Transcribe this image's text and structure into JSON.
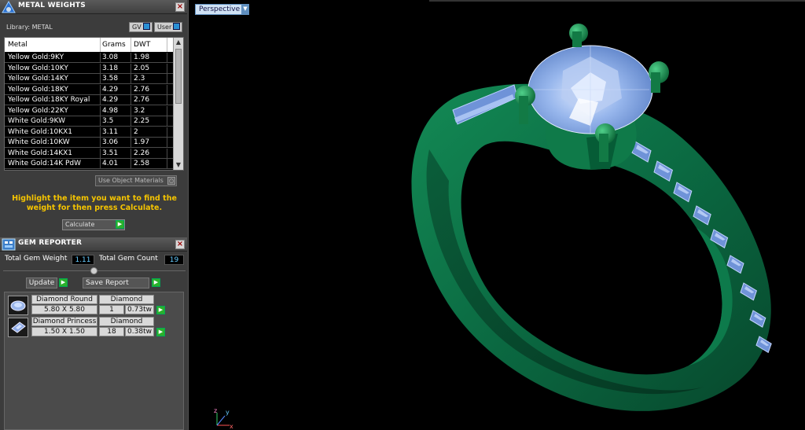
{
  "metal_panel": {
    "title": "METAL WEIGHTS",
    "library_label": "Library:  METAL",
    "btn_gv": "GV",
    "btn_user": "User",
    "columns": [
      "Metal",
      "Grams",
      "DWT"
    ],
    "rows": [
      [
        "Yellow Gold:9KY",
        "3.08",
        "1.98"
      ],
      [
        "Yellow Gold:10KY",
        "3.18",
        "2.05"
      ],
      [
        "Yellow Gold:14KY",
        "3.58",
        "2.3"
      ],
      [
        "Yellow Gold:18KY",
        "4.29",
        "2.76"
      ],
      [
        "Yellow Gold:18KY Royal",
        "4.29",
        "2.76"
      ],
      [
        "Yellow Gold:22KY",
        "4.98",
        "3.2"
      ],
      [
        "White Gold:9KW",
        "3.5",
        "2.25"
      ],
      [
        "White Gold:10KX1",
        "3.11",
        "2"
      ],
      [
        "White Gold:10KW",
        "3.06",
        "1.97"
      ],
      [
        "White Gold:14KX1",
        "3.51",
        "2.26"
      ],
      [
        "White Gold:14K PdW",
        "4.01",
        "2.58"
      ]
    ],
    "use_object_materials": "Use Object Materials",
    "hint": "Highlight the item you want to find the weight for then press Calculate.",
    "calculate_label": "Calculate"
  },
  "gem_panel": {
    "title": "GEM REPORTER",
    "total_weight_label": "Total Gem Weight",
    "total_weight_value": "1.11",
    "total_count_label": "Total Gem Count",
    "total_count_value": "19",
    "update_label": "Update",
    "save_report_label": "Save Report",
    "gems": [
      {
        "shape": "Diamond Round",
        "material": "Diamond",
        "size": "5.80 X 5.80",
        "count": "1",
        "weight": "0.73tw",
        "icon": "round-gem-icon"
      },
      {
        "shape": "Diamond Princess",
        "material": "Diamond",
        "size": "1.50 X 1.50",
        "count": "18",
        "weight": "0.38tw",
        "icon": "princess-gem-icon"
      }
    ]
  },
  "viewport": {
    "view_name": "Perspective",
    "axis_labels": [
      "z",
      "y",
      "x"
    ],
    "colors": {
      "metal": "#0d6b45",
      "gem": "#8fb3e8",
      "prong": "#1f8a4e",
      "background": "#000000"
    }
  }
}
